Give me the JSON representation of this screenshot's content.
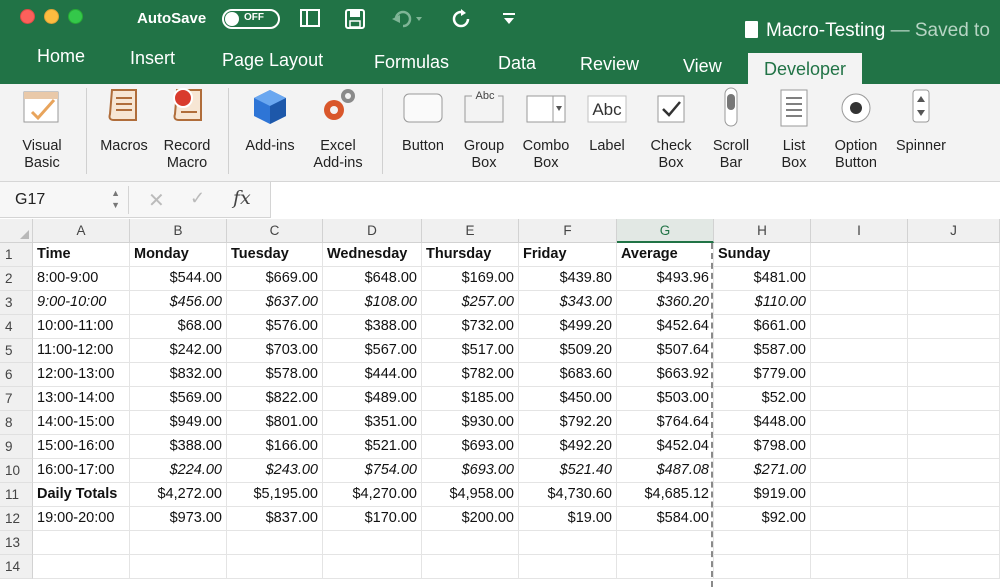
{
  "titlebar": {
    "autosave_label": "AutoSave",
    "autosave_state": "OFF",
    "document_title": "Macro-Testing",
    "saved_status": " — Saved to"
  },
  "tabs": [
    {
      "label": "Home"
    },
    {
      "label": "Insert"
    },
    {
      "label": "Page Layout"
    },
    {
      "label": "Formulas"
    },
    {
      "label": "Data"
    },
    {
      "label": "Review"
    },
    {
      "label": "View"
    },
    {
      "label": "Developer",
      "active": true
    }
  ],
  "ribbon": {
    "visual_basic": {
      "line1": "Visual",
      "line2": "Basic",
      "icon": "visual-basic-icon"
    },
    "macros": {
      "line1": "Macros",
      "icon": "macros-scroll-icon"
    },
    "record_macro": {
      "line1": "Record",
      "line2": "Macro",
      "icon": "record-macro-icon"
    },
    "addins": {
      "line1": "Add-ins",
      "icon": "addins-cube-icon"
    },
    "excel_addins": {
      "line1": "Excel",
      "line2": "Add-ins",
      "icon": "excel-addins-gears-icon"
    },
    "button": {
      "line1": "Button"
    },
    "group_box": {
      "line1": "Group",
      "line2": "Box",
      "icon_text": "Abc"
    },
    "combo_box": {
      "line1": "Combo",
      "line2": "Box"
    },
    "label": {
      "line1": "Label",
      "icon_text": "Abc"
    },
    "check_box": {
      "line1": "Check",
      "line2": "Box"
    },
    "scroll_bar": {
      "line1": "Scroll",
      "line2": "Bar"
    },
    "list_box": {
      "line1": "List",
      "line2": "Box"
    },
    "option_button": {
      "line1": "Option",
      "line2": "Button"
    },
    "spinner": {
      "line1": "Spinner"
    }
  },
  "formula_bar": {
    "name_box": "G17",
    "fx_label": "fx",
    "content": ""
  },
  "grid": {
    "selected_column": "G",
    "columns": [
      "A",
      "B",
      "C",
      "D",
      "E",
      "F",
      "G",
      "H",
      "I",
      "J"
    ],
    "row_numbers": [
      "1",
      "2",
      "3",
      "4",
      "5",
      "6",
      "7",
      "8",
      "9",
      "10",
      "11",
      "12",
      "13",
      "14"
    ],
    "header_row": [
      "Time",
      "Monday",
      "Tuesday",
      "Wednesday",
      "Thursday",
      "Friday",
      "Average",
      "Sunday"
    ],
    "rows": [
      [
        "8:00-9:00",
        "$544.00",
        "$669.00",
        "$648.00",
        "$169.00",
        "$439.80",
        "$493.96",
        "$481.00"
      ],
      [
        "9:00-10:00",
        "$456.00",
        "$637.00",
        "$108.00",
        "$257.00",
        "$343.00",
        "$360.20",
        "$110.00"
      ],
      [
        "10:00-11:00",
        "$68.00",
        "$576.00",
        "$388.00",
        "$732.00",
        "$499.20",
        "$452.64",
        "$661.00"
      ],
      [
        "11:00-12:00",
        "$242.00",
        "$703.00",
        "$567.00",
        "$517.00",
        "$509.20",
        "$507.64",
        "$587.00"
      ],
      [
        "12:00-13:00",
        "$832.00",
        "$578.00",
        "$444.00",
        "$782.00",
        "$683.60",
        "$663.92",
        "$779.00"
      ],
      [
        "13:00-14:00",
        "$569.00",
        "$822.00",
        "$489.00",
        "$185.00",
        "$450.00",
        "$503.00",
        "$52.00"
      ],
      [
        "14:00-15:00",
        "$949.00",
        "$801.00",
        "$351.00",
        "$930.00",
        "$792.20",
        "$764.64",
        "$448.00"
      ],
      [
        "15:00-16:00",
        "$388.00",
        "$166.00",
        "$521.00",
        "$693.00",
        "$492.20",
        "$452.04",
        "$798.00"
      ],
      [
        "16:00-17:00",
        "$224.00",
        "$243.00",
        "$754.00",
        "$693.00",
        "$521.40",
        "$487.08",
        "$271.00"
      ],
      [
        "Daily Totals",
        "$4,272.00",
        "$5,195.00",
        "$4,270.00",
        "$4,958.00",
        "$4,730.60",
        "$4,685.12",
        "$919.00"
      ],
      [
        "19:00-20:00",
        "$973.00",
        "$837.00",
        "$170.00",
        "$200.00",
        "$19.00",
        "$584.00",
        "$92.00"
      ]
    ],
    "italic_rows": [
      1,
      8
    ],
    "bold_rows": [
      9
    ]
  }
}
